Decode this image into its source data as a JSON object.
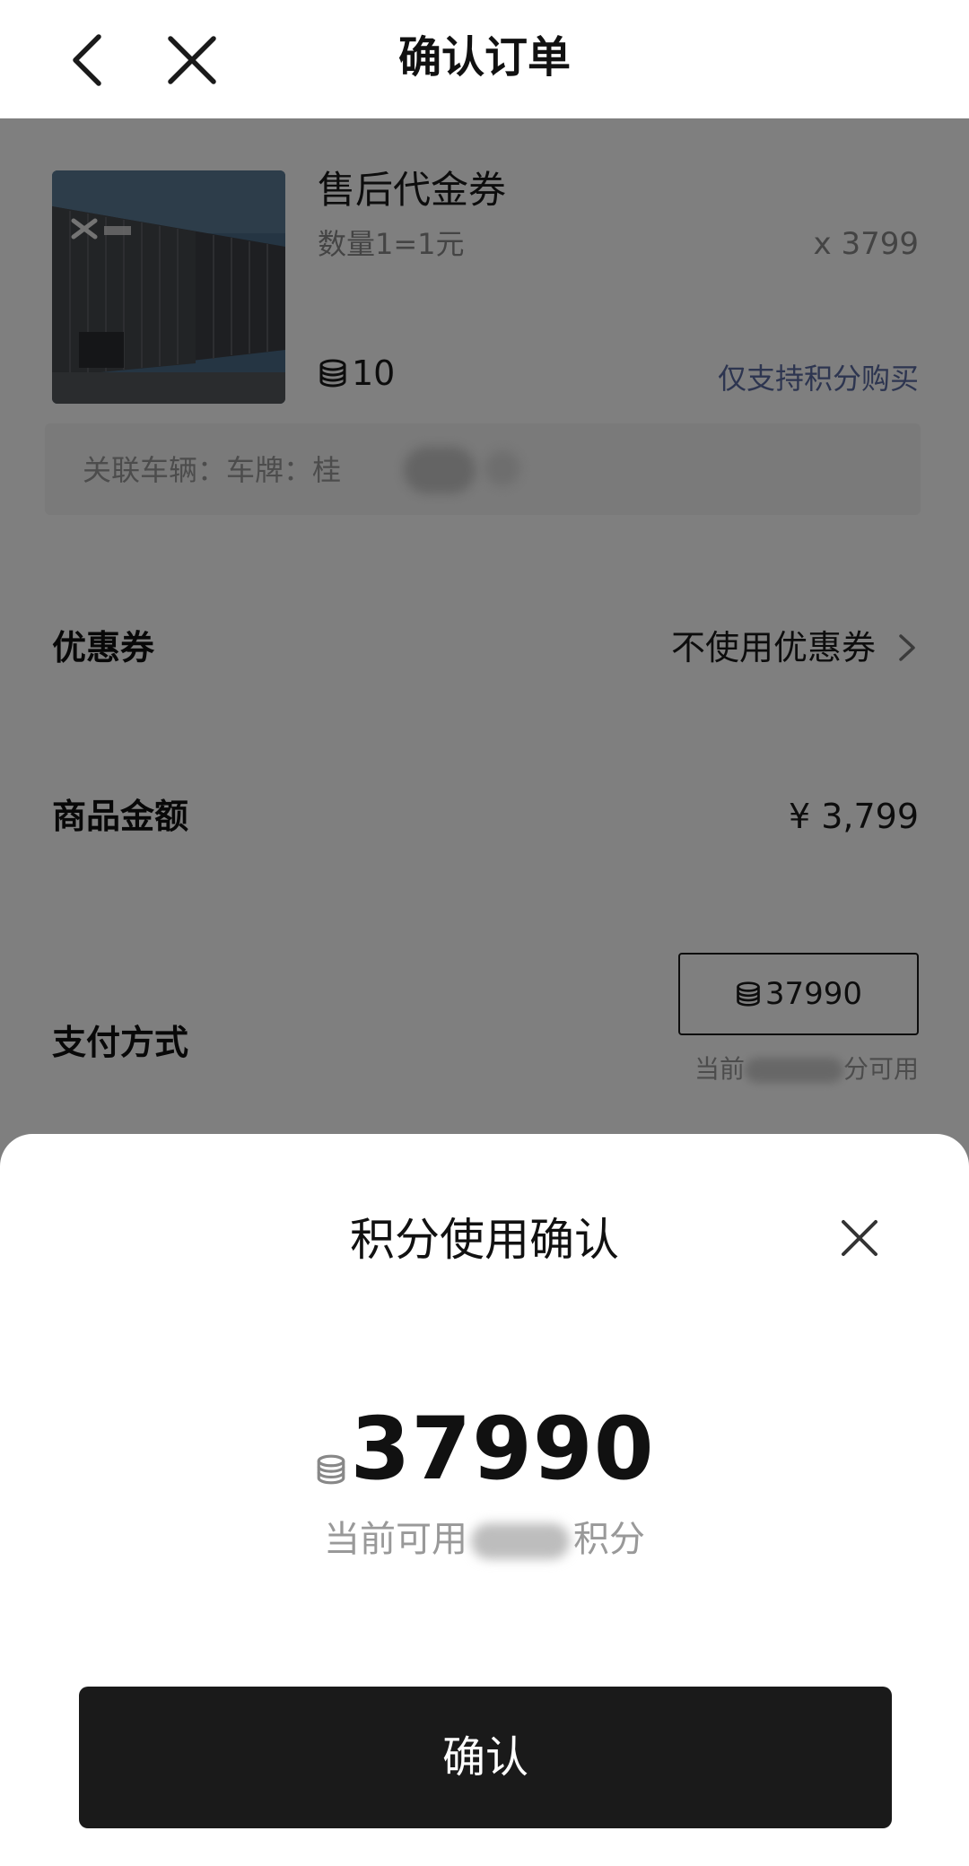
{
  "header": {
    "title": "确认订单",
    "back_icon": "chevron-left-icon",
    "close_icon": "close-icon"
  },
  "product": {
    "name": "售后代金券",
    "spec": "数量1=1元",
    "quantity": "x 3799",
    "price": "10",
    "note": "仅支持积分购买",
    "thumbnail": "xpeng-building-photo",
    "vehicle_label": "关联车辆：车牌：桂"
  },
  "coupon": {
    "label": "优惠券",
    "value": "不使用优惠券"
  },
  "amount": {
    "label": "商品金额",
    "value": "¥ 3,799"
  },
  "payment": {
    "label": "支付方式",
    "points": "37990",
    "available_prefix": "当前",
    "available_suffix": "分可用"
  },
  "sheet": {
    "title": "积分使用确认",
    "points": "37990",
    "available_prefix": "当前可用",
    "available_suffix": "积分",
    "confirm_label": "确认"
  },
  "colors": {
    "overlay": "rgba(0,0,0,0.5)",
    "button_bg": "#1a1a1a",
    "note_text": "#5a6aa0"
  }
}
